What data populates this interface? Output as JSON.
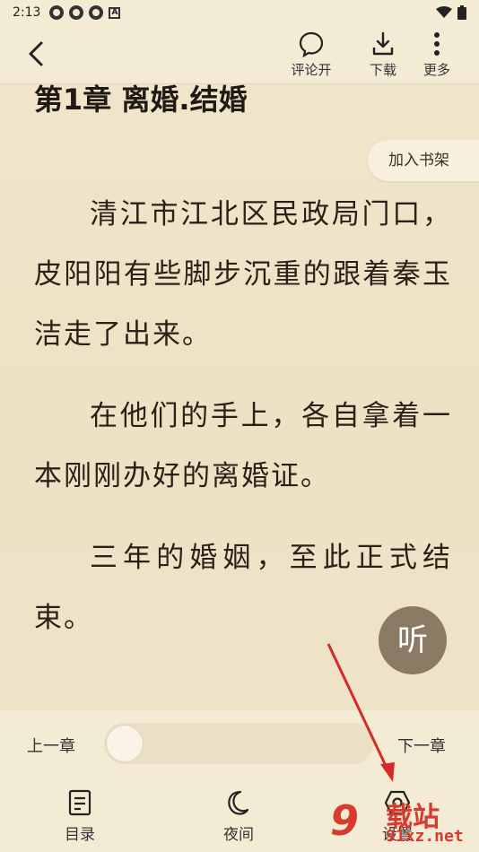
{
  "status_bar": {
    "time": "2:13",
    "icons": [
      "app-icon",
      "app-icon",
      "app-icon",
      "a-badge-icon"
    ],
    "right_icons": [
      "wifi-icon",
      "battery-icon"
    ]
  },
  "toolbar": {
    "comment_label": "评论开",
    "download_label": "下载",
    "more_label": "更多"
  },
  "chapter": {
    "title": "第1章 离婚.结婚"
  },
  "add_shelf_label": "加入书架",
  "content": {
    "paragraphs": [
      "清江市江北区民政局门口，皮阳阳有些脚步沉重的跟着秦玉洁走了出来。",
      "在他们的手上，各自拿着一本刚刚办好的离婚证。",
      "三年的婚姻，至此正式结束。"
    ]
  },
  "listen_label": "听",
  "bottom": {
    "prev_label": "上一章",
    "next_label": "下一章",
    "progress": 0.0,
    "catalog_label": "目录",
    "night_label": "夜间",
    "settings_label": "设置"
  },
  "watermark": {
    "logo": "9",
    "text": "载站",
    "url": "91xz.net"
  },
  "colors": {
    "background": "#efe3c7",
    "listen_button": "#8c7b64",
    "arrow": "#d42a2a",
    "watermark": "#d83a2e"
  }
}
